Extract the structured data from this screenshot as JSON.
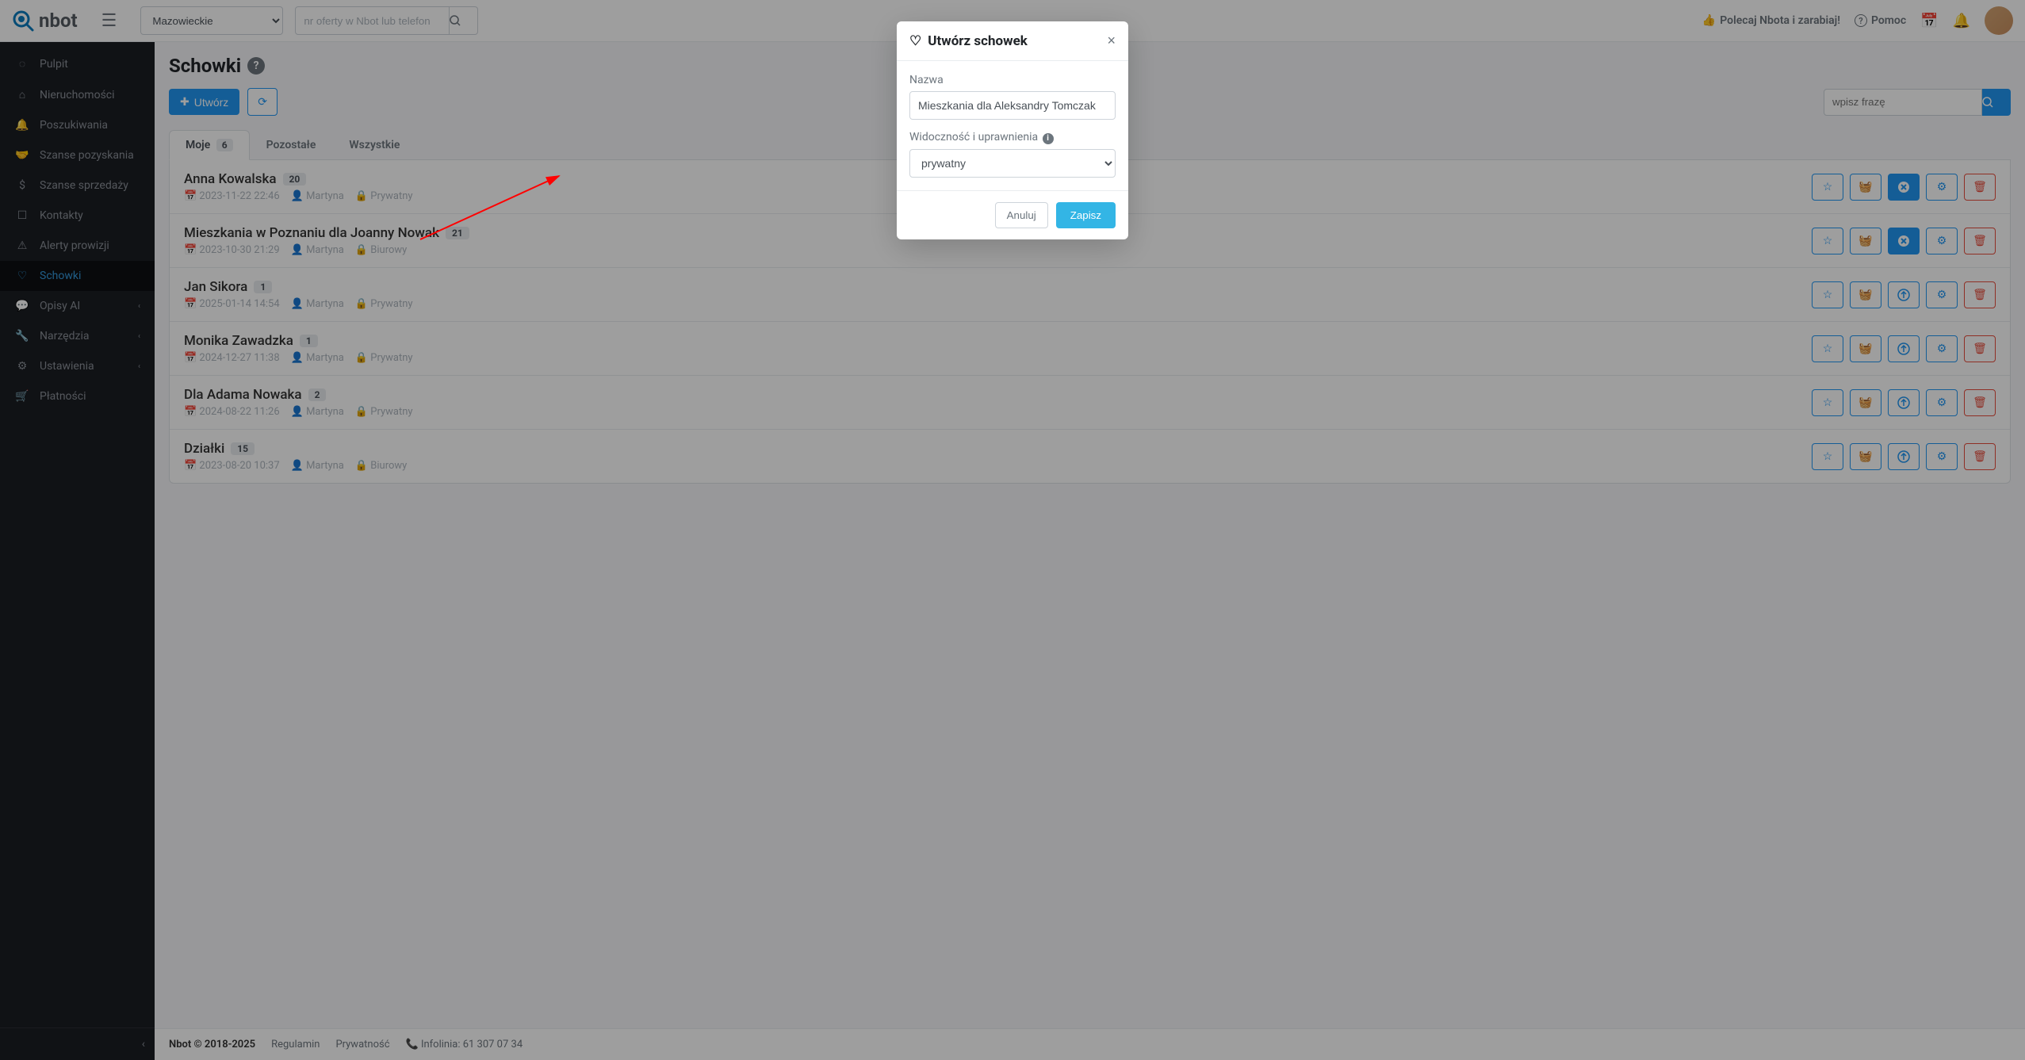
{
  "topbar": {
    "logo_text": "nbot",
    "region": "Mazowieckie",
    "offer_placeholder": "nr oferty w Nbot lub telefon",
    "recommend": "Polecaj Nbota i zarabiaj!",
    "help": "Pomoc"
  },
  "sidebar": {
    "items": [
      {
        "label": "Pulpit",
        "icon": "◌"
      },
      {
        "label": "Nieruchomości",
        "icon": "⌂"
      },
      {
        "label": "Poszukiwania",
        "icon": "🔔"
      },
      {
        "label": "Szanse pozyskania",
        "icon": "🤝"
      },
      {
        "label": "Szanse sprzedaży",
        "icon": "$"
      },
      {
        "label": "Kontakty",
        "icon": "☐"
      },
      {
        "label": "Alerty prowizji",
        "icon": "⚠"
      },
      {
        "label": "Schowki",
        "icon": "♡",
        "active": true
      },
      {
        "label": "Opisy AI",
        "icon": "💬",
        "expand": true
      },
      {
        "label": "Narzędzia",
        "icon": "🔧",
        "expand": true
      },
      {
        "label": "Ustawienia",
        "icon": "⚙",
        "expand": true
      },
      {
        "label": "Płatności",
        "icon": "🛒"
      }
    ]
  },
  "page": {
    "title": "Schowki",
    "create_btn": "Utwórz",
    "search_placeholder": "wpisz frazę"
  },
  "tabs": [
    {
      "label": "Moje",
      "count": "6",
      "active": true
    },
    {
      "label": "Pozostałe"
    },
    {
      "label": "Wszystkie"
    }
  ],
  "list": [
    {
      "title": "Anna Kowalska",
      "count": "20",
      "date": "2023-11-22 22:46",
      "user": "Martyna",
      "visibility": "Prywatny",
      "filled_action": true
    },
    {
      "title": "Mieszkania w Poznaniu dla Joanny Nowak",
      "count": "21",
      "date": "2023-10-30 21:29",
      "user": "Martyna",
      "visibility": "Biurowy",
      "filled_action": true
    },
    {
      "title": "Jan Sikora",
      "count": "1",
      "date": "2025-01-14 14:54",
      "user": "Martyna",
      "visibility": "Prywatny"
    },
    {
      "title": "Monika Zawadzka",
      "count": "1",
      "date": "2024-12-27 11:38",
      "user": "Martyna",
      "visibility": "Prywatny"
    },
    {
      "title": "Dla Adama Nowaka",
      "count": "2",
      "date": "2024-08-22 11:26",
      "user": "Martyna",
      "visibility": "Prywatny"
    },
    {
      "title": "Działki",
      "count": "15",
      "date": "2023-08-20 10:37",
      "user": "Martyna",
      "visibility": "Biurowy"
    }
  ],
  "footer": {
    "copy": "Nbot © 2018-2025",
    "terms": "Regulamin",
    "privacy": "Prywatność",
    "hotline": "Infolinia: 61 307 07 34"
  },
  "modal": {
    "title": "Utwórz schowek",
    "name_label": "Nazwa",
    "name_value": "Mieszkania dla Aleksandry Tomczak",
    "vis_label": "Widoczność i uprawnienia",
    "vis_value": "prywatny",
    "cancel": "Anuluj",
    "save": "Zapisz"
  }
}
